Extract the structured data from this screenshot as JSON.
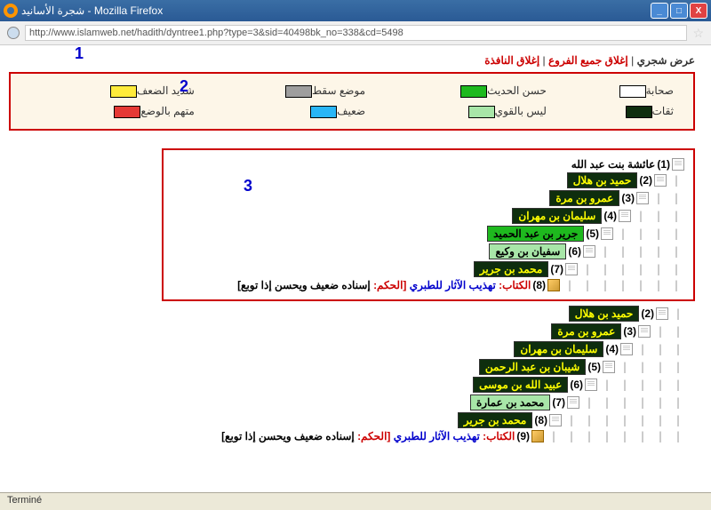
{
  "window": {
    "title": "شجرة الأسانيد - Mozilla Firefox",
    "url": "http://www.islamweb.net/hadith/dyntree1.php?type=3&sid=40498bk_no=338&cd=5498"
  },
  "annotations": {
    "a1": "1",
    "a2": "2",
    "a3": "3"
  },
  "topnav": {
    "tree_view": "عرض شجري",
    "close_all": "إغلاق جميع الفروع",
    "close_window": "إغلاق النافذة"
  },
  "legend": {
    "r1c1": {
      "label": "صحابة",
      "color": "#ffffff"
    },
    "r1c2": {
      "label": "حسن الحديث",
      "color": "#1eb91e"
    },
    "r1c3": {
      "label": "موضع سقط",
      "color": "#9e9e9e"
    },
    "r1c4": {
      "label": "شديد الضعف",
      "color": "#ffeb3b"
    },
    "r2c1": {
      "label": "ثقات",
      "color": "#0e2e0e"
    },
    "r2c2": {
      "label": "ليس بالقوي",
      "color": "#a8e6a8"
    },
    "r2c3": {
      "label": "ضعيف",
      "color": "#29b6f6"
    },
    "r2c4": {
      "label": "متهم بالوضع",
      "color": "#e53935"
    }
  },
  "tree1": {
    "n1": {
      "num": "(1)",
      "name": "عائشة بنت عبد الله"
    },
    "n2": {
      "num": "(2)",
      "name": "حميد بن هلال",
      "cls": "bg-darkgreen"
    },
    "n3": {
      "num": "(3)",
      "name": "عمرو بن مرة",
      "cls": "bg-darkgreen"
    },
    "n4": {
      "num": "(4)",
      "name": "سليمان بن مهران",
      "cls": "bg-darkgreen"
    },
    "n5": {
      "num": "(5)",
      "name": "جرير بن عبد الحميد",
      "cls": "bg-green"
    },
    "n6": {
      "num": "(6)",
      "name": "سفيان بن وكيع",
      "cls": "bg-ltgreen"
    },
    "n7": {
      "num": "(7)",
      "name": "محمد بن جرير",
      "cls": "bg-darkgreen"
    },
    "n8": {
      "num": "(8)",
      "kitab": "الكتاب:",
      "title": "تهذيب الآثار للطبري",
      "hukm": "[الحكم:",
      "rest": "إسناده ضعيف ويحسن إذا توبع]"
    }
  },
  "tree2": {
    "n2": {
      "num": "(2)",
      "name": "حميد بن هلال",
      "cls": "bg-darkgreen"
    },
    "n3": {
      "num": "(3)",
      "name": "عمرو بن مرة",
      "cls": "bg-darkgreen"
    },
    "n4": {
      "num": "(4)",
      "name": "سليمان بن مهران",
      "cls": "bg-darkgreen"
    },
    "n5": {
      "num": "(5)",
      "name": "شيبان بن عبد الرحمن",
      "cls": "bg-darkgreen"
    },
    "n6": {
      "num": "(6)",
      "name": "عبيد الله بن موسى",
      "cls": "bg-darkgreen"
    },
    "n7": {
      "num": "(7)",
      "name": "محمد بن عمارة",
      "cls": "bg-ltgreen"
    },
    "n8": {
      "num": "(8)",
      "name": "محمد بن جرير",
      "cls": "bg-darkgreen"
    },
    "n9": {
      "num": "(9)",
      "kitab": "الكتاب:",
      "title": "تهذيب الآثار للطبري",
      "hukm": "[الحكم:",
      "rest": "إسناده ضعيف ويحسن إذا توبع]"
    }
  },
  "status": "Terminé"
}
